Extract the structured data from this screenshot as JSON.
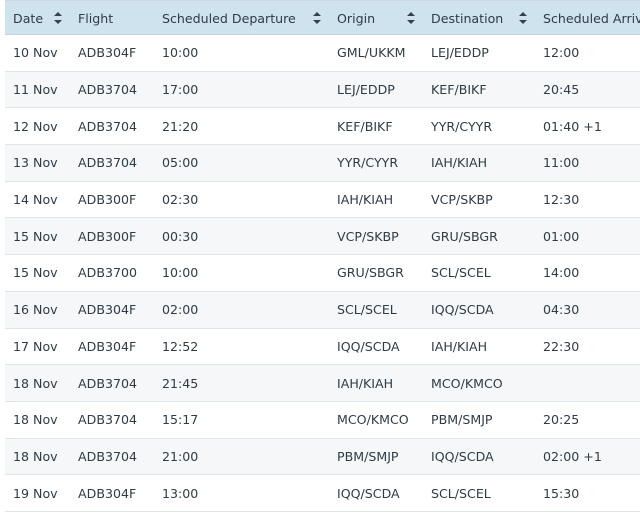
{
  "table": {
    "headers": [
      {
        "key": "date",
        "label": "Date"
      },
      {
        "key": "flight",
        "label": "Flight"
      },
      {
        "key": "scheduled_departure",
        "label": "Scheduled Departure"
      },
      {
        "key": "origin",
        "label": "Origin"
      },
      {
        "key": "destination",
        "label": "Destination"
      },
      {
        "key": "scheduled_arrival",
        "label": "Scheduled Arrival"
      }
    ],
    "rows": [
      [
        "10 Nov",
        "ADB304F",
        "10:00",
        "GML/UKKM",
        "LEJ/EDDP",
        "12:00"
      ],
      [
        "11 Nov",
        "ADB3704",
        "17:00",
        "LEJ/EDDP",
        "KEF/BIKF",
        "20:45"
      ],
      [
        "12 Nov",
        "ADB3704",
        "21:20",
        "KEF/BIKF",
        "YYR/CYYR",
        "01:40 +1"
      ],
      [
        "13 Nov",
        "ADB3704",
        "05:00",
        "YYR/CYYR",
        "IAH/KIAH",
        "11:00"
      ],
      [
        "14 Nov",
        "ADB300F",
        "02:30",
        "IAH/KIAH",
        "VCP/SKBP",
        "12:30"
      ],
      [
        "15 Nov",
        "ADB300F",
        "00:30",
        "VCP/SKBP",
        "GRU/SBGR",
        "01:00"
      ],
      [
        "15 Nov",
        "ADB3700",
        "10:00",
        "GRU/SBGR",
        "SCL/SCEL",
        "14:00"
      ],
      [
        "16 Nov",
        "ADB304F",
        "02:00",
        "SCL/SCEL",
        "IQQ/SCDA",
        "04:30"
      ],
      [
        "17 Nov",
        "ADB304F",
        "12:52",
        "IQQ/SCDA",
        "IAH/KIAH",
        "22:30"
      ],
      [
        "18 Nov",
        "ADB3704",
        "21:45",
        "IAH/KIAH",
        "MCO/KMCO",
        ""
      ],
      [
        "18 Nov",
        "ADB3704",
        "15:17",
        "MCO/KMCO",
        "PBM/SMJP",
        "20:25"
      ],
      [
        "18 Nov",
        "ADB3704",
        "21:00",
        "PBM/SMJP",
        "IQQ/SCDA",
        "02:00 +1"
      ],
      [
        "19 Nov",
        "ADB304F",
        "13:00",
        "IQQ/SCDA",
        "SCL/SCEL",
        "15:30"
      ]
    ]
  },
  "icons": {
    "sort": "sort-icon"
  },
  "colors": {
    "header_background": "#cfe3ee",
    "row_stripe": "#f5f7f8",
    "text": "#2f3b46"
  }
}
